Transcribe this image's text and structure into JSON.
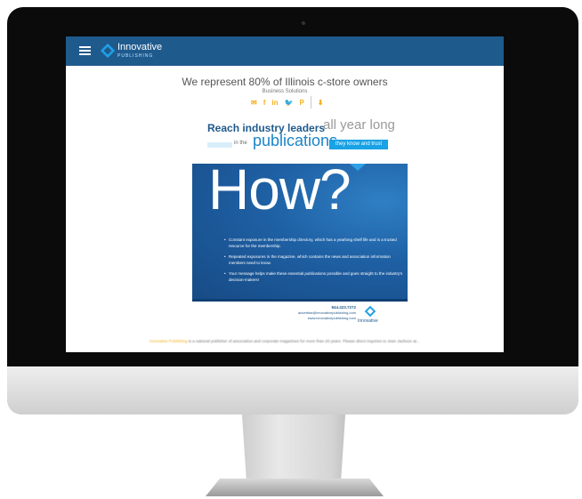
{
  "screen": {
    "header": {
      "logo_title": "Innovative",
      "logo_subtitle": "PUBLISHING",
      "brand_color": "#1f5a8d"
    },
    "headline": "We represent 80% of Illinois c-store owners",
    "subheadline": "Business Solutions",
    "social_icons": [
      "email-icon",
      "facebook-icon",
      "linkedin-icon",
      "twitter-icon",
      "pinterest-icon",
      "download-icon"
    ],
    "social_glyphs": [
      "✉",
      "f",
      "in",
      "🐦",
      "P",
      "⬇"
    ],
    "reach": {
      "line1_bold": "Reach industry leaders",
      "line1_light": "all year long",
      "line2_small": "in the",
      "line2_big": "publications",
      "tag": "they know and trust"
    },
    "ad": {
      "title": "How?",
      "bullets": [
        "Constant exposure in the membership directory, which has a yearlong shelf life and is a trusted resource for the membership.",
        "Repeated exposures in the magazine, which contains the news and association information members need to know.",
        "Your message helps make these essential publications possible and goes straight to the industry's decision-makers!"
      ]
    },
    "contact": {
      "phone": "844.423.7272",
      "email": "advertise@innovativepublishing.com",
      "website": "www.innovativepublishing.com",
      "logo_text": "Innovative"
    },
    "footer": {
      "lead": "Innovative Publishing",
      "text": "is a national publisher of association and corporate magazines for more than 20 years. Please direct inquiries to Jean Jackson at..."
    }
  }
}
